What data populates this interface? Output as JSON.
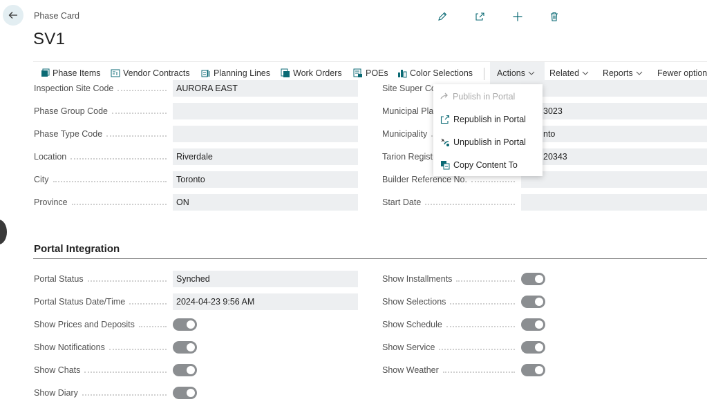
{
  "page": {
    "caption": "Phase Card",
    "title": "SV1"
  },
  "actionbar": {
    "items": [
      {
        "label": "Phase Items",
        "icon": "phase-items-icon"
      },
      {
        "label": "Vendor Contracts",
        "icon": "vendor-contracts-icon"
      },
      {
        "label": "Planning Lines",
        "icon": "planning-lines-icon"
      },
      {
        "label": "Work Orders",
        "icon": "work-orders-icon"
      },
      {
        "label": "POEs",
        "icon": "poes-icon"
      },
      {
        "label": "Color Selections",
        "icon": "color-selections-icon"
      }
    ],
    "actions": "Actions",
    "related": "Related",
    "reports": "Reports",
    "fewer": "Fewer option"
  },
  "actions_menu": [
    {
      "label": "Publish in Portal",
      "enabled": false
    },
    {
      "label": "Republish in Portal",
      "enabled": true
    },
    {
      "label": "Unpublish in Portal",
      "enabled": true
    },
    {
      "label": "Copy Content To",
      "enabled": true
    }
  ],
  "general": {
    "left": [
      {
        "label": "Inspection Site Code",
        "value": "AURORA EAST"
      },
      {
        "label": "Phase Group Code",
        "value": ""
      },
      {
        "label": "Phase Type Code",
        "value": ""
      },
      {
        "label": "Location",
        "value": "Riverdale"
      },
      {
        "label": "City",
        "value": "Toronto"
      },
      {
        "label": "Province",
        "value": "ON"
      }
    ],
    "right": [
      {
        "label": "Site Super Co",
        "value": ""
      },
      {
        "label": "Municipal Plan",
        "value": "3023"
      },
      {
        "label": "Municipality",
        "value": "nto"
      },
      {
        "label": "Tarion Registr",
        "value": "20343"
      },
      {
        "label": "Builder Reference No.",
        "value": ""
      },
      {
        "label": "Start Date",
        "value": ""
      }
    ]
  },
  "portal": {
    "section_title": "Portal Integration",
    "portal_status_label": "Portal Status",
    "portal_status_value": "Synched",
    "portal_status_date_label": "Portal Status Date/Time",
    "portal_status_date_value": "2024-04-23 9:56 AM",
    "left_toggles": [
      {
        "label": "Show Prices and Deposits",
        "on": true
      },
      {
        "label": "Show Notifications",
        "on": true
      },
      {
        "label": "Show Chats",
        "on": true
      },
      {
        "label": "Show Diary",
        "on": true
      }
    ],
    "right_toggles": [
      {
        "label": "Show Installments",
        "on": true
      },
      {
        "label": "Show Selections",
        "on": true
      },
      {
        "label": "Show Schedule",
        "on": true
      },
      {
        "label": "Show Service",
        "on": true
      },
      {
        "label": "Show Weather",
        "on": true
      }
    ]
  },
  "colors": {
    "accent": "#0b6a74",
    "field_bg": "#edeff1",
    "toggle": "#8b8e91"
  }
}
